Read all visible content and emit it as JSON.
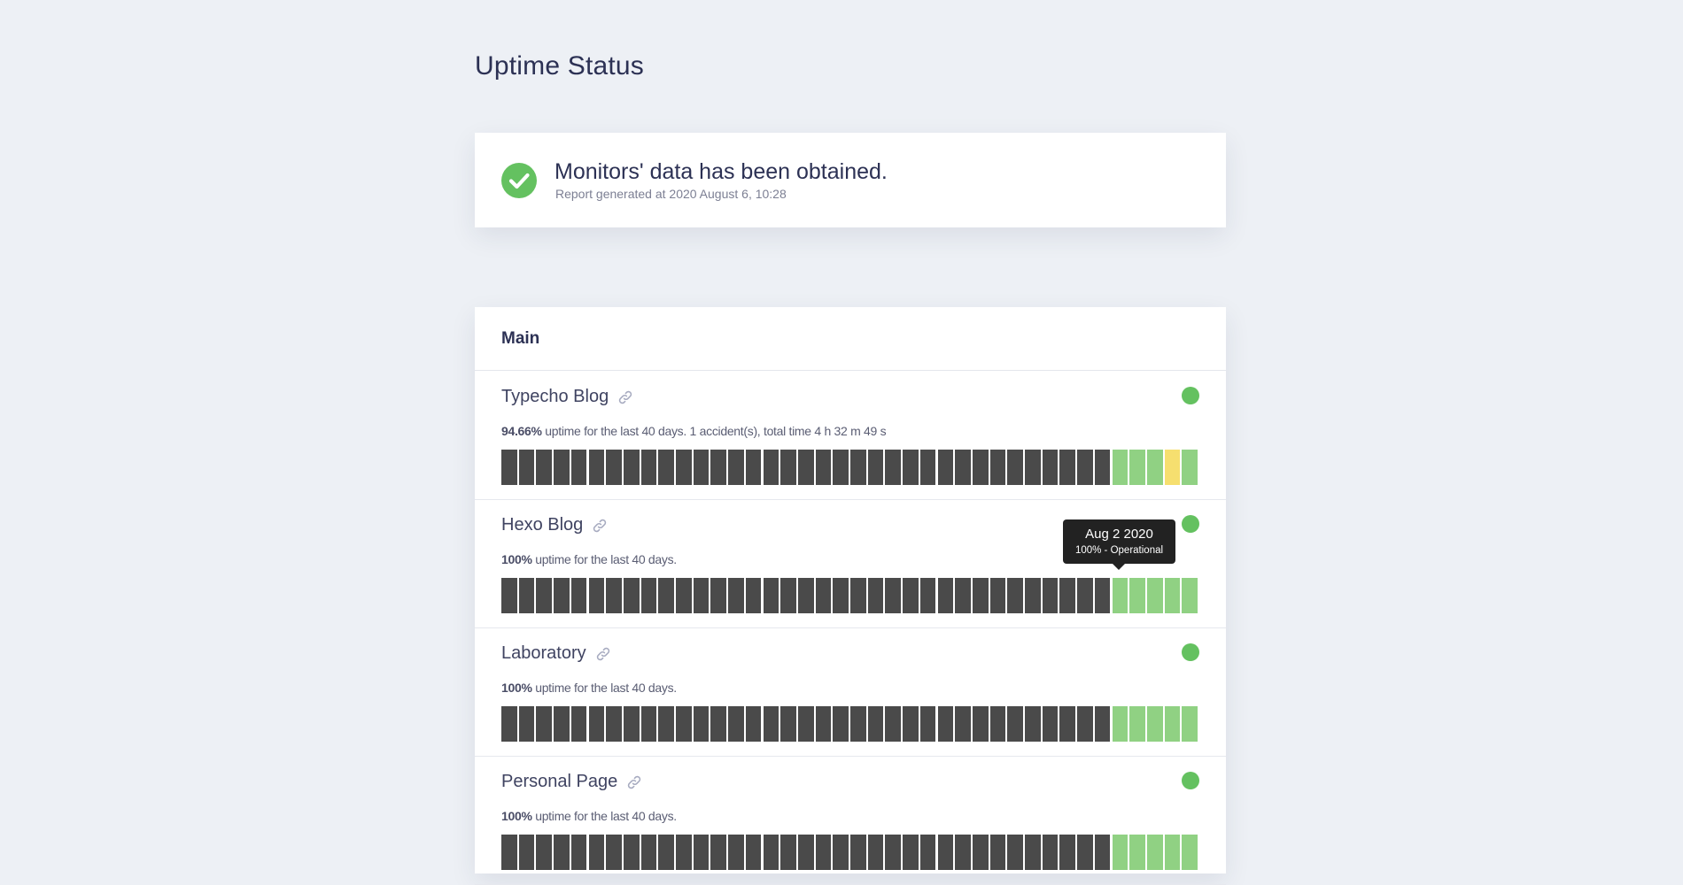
{
  "page": {
    "title": "Uptime Status"
  },
  "summary": {
    "icon": "check-circle-icon",
    "headline": "Monitors' data has been obtained.",
    "generated": "Report generated at 2020 August 6, 10:28"
  },
  "group": {
    "title": "Main",
    "monitors": [
      {
        "name": "Typecho Blog",
        "uptime": "94.66%",
        "detail": "uptime for the last 40 days. 1 accident(s), total time 4 h 32 m 49 s",
        "status_color": "#64c160",
        "bars": [
          "nodata",
          "nodata",
          "nodata",
          "nodata",
          "nodata",
          "nodata",
          "nodata",
          "nodata",
          "nodata",
          "nodata",
          "nodata",
          "nodata",
          "nodata",
          "nodata",
          "nodata",
          "nodata",
          "nodata",
          "nodata",
          "nodata",
          "nodata",
          "nodata",
          "nodata",
          "nodata",
          "nodata",
          "nodata",
          "nodata",
          "nodata",
          "nodata",
          "nodata",
          "nodata",
          "nodata",
          "nodata",
          "nodata",
          "nodata",
          "nodata",
          "ok",
          "ok",
          "ok",
          "warn",
          "ok"
        ]
      },
      {
        "name": "Hexo Blog",
        "uptime": "100%",
        "detail": "uptime for the last 40 days.",
        "status_color": "#64c160",
        "bars": [
          "nodata",
          "nodata",
          "nodata",
          "nodata",
          "nodata",
          "nodata",
          "nodata",
          "nodata",
          "nodata",
          "nodata",
          "nodata",
          "nodata",
          "nodata",
          "nodata",
          "nodata",
          "nodata",
          "nodata",
          "nodata",
          "nodata",
          "nodata",
          "nodata",
          "nodata",
          "nodata",
          "nodata",
          "nodata",
          "nodata",
          "nodata",
          "nodata",
          "nodata",
          "nodata",
          "nodata",
          "nodata",
          "nodata",
          "nodata",
          "nodata",
          "ok",
          "ok",
          "ok",
          "ok",
          "ok"
        ]
      },
      {
        "name": "Laboratory",
        "uptime": "100%",
        "detail": "uptime for the last 40 days.",
        "status_color": "#64c160",
        "bars": [
          "nodata",
          "nodata",
          "nodata",
          "nodata",
          "nodata",
          "nodata",
          "nodata",
          "nodata",
          "nodata",
          "nodata",
          "nodata",
          "nodata",
          "nodata",
          "nodata",
          "nodata",
          "nodata",
          "nodata",
          "nodata",
          "nodata",
          "nodata",
          "nodata",
          "nodata",
          "nodata",
          "nodata",
          "nodata",
          "nodata",
          "nodata",
          "nodata",
          "nodata",
          "nodata",
          "nodata",
          "nodata",
          "nodata",
          "nodata",
          "nodata",
          "ok",
          "ok",
          "ok",
          "ok",
          "ok"
        ]
      },
      {
        "name": "Personal Page",
        "uptime": "100%",
        "detail": "uptime for the last 40 days.",
        "status_color": "#64c160",
        "bars": [
          "nodata",
          "nodata",
          "nodata",
          "nodata",
          "nodata",
          "nodata",
          "nodata",
          "nodata",
          "nodata",
          "nodata",
          "nodata",
          "nodata",
          "nodata",
          "nodata",
          "nodata",
          "nodata",
          "nodata",
          "nodata",
          "nodata",
          "nodata",
          "nodata",
          "nodata",
          "nodata",
          "nodata",
          "nodata",
          "nodata",
          "nodata",
          "nodata",
          "nodata",
          "nodata",
          "nodata",
          "nodata",
          "nodata",
          "nodata",
          "nodata",
          "ok",
          "ok",
          "ok",
          "ok",
          "ok"
        ]
      }
    ]
  },
  "tooltip": {
    "date": "Aug 2 2020",
    "status": "100% - Operational"
  },
  "colors": {
    "nodata": "#4a4a4a",
    "ok": "#90d183",
    "warn": "#f6df6f",
    "status_dot": "#64c160"
  }
}
